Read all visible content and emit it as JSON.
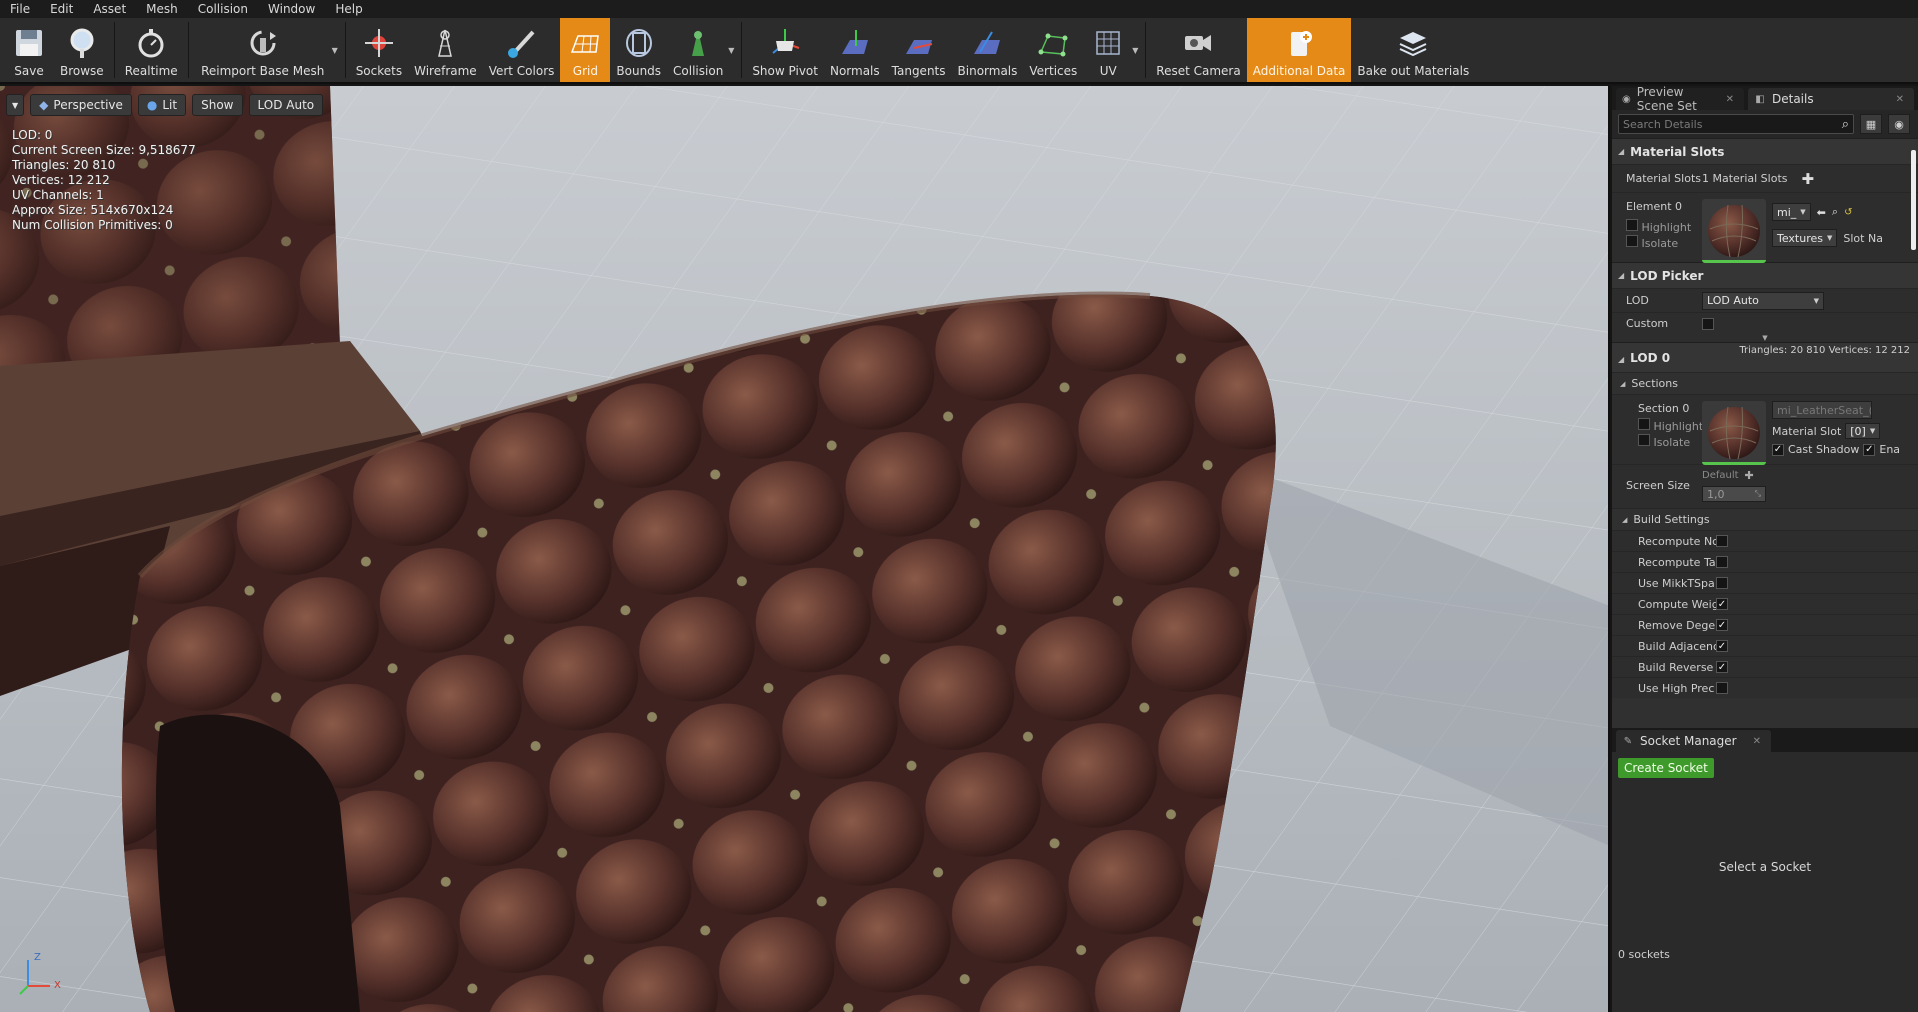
{
  "menu": [
    "File",
    "Edit",
    "Asset",
    "Mesh",
    "Collision",
    "Window",
    "Help"
  ],
  "toolbar": {
    "save": "Save",
    "browse": "Browse",
    "realtime": "Realtime",
    "reimport": "Reimport Base Mesh",
    "sockets": "Sockets",
    "wireframe": "Wireframe",
    "vert_colors": "Vert Colors",
    "grid": "Grid",
    "bounds": "Bounds",
    "collision": "Collision",
    "show_pivot": "Show Pivot",
    "normals": "Normals",
    "tangents": "Tangents",
    "binormals": "Binormals",
    "vertices": "Vertices",
    "uv": "UV",
    "reset_camera": "Reset Camera",
    "additional_data": "Additional Data",
    "bake_out_materials": "Bake out Materials",
    "accent": "#e58a17"
  },
  "viewport": {
    "perspective": "Perspective",
    "lit": "Lit",
    "show": "Show",
    "lod_auto": "LOD Auto",
    "stats": {
      "lod": "LOD:  0",
      "screen_size": "Current Screen Size:  9,518677",
      "triangles": "Triangles:  20 810",
      "vertices": "Vertices:  12 212",
      "uv_channels": "UV Channels:  1",
      "approx_size": "Approx Size: 514x670x124",
      "num_collision": "Num Collision Primitives:  0"
    },
    "axis_x": "X",
    "axis_z": "Z"
  },
  "tabs": {
    "preview_scene": "Preview Scene Set",
    "details": "Details",
    "socket_manager": "Socket Manager"
  },
  "details": {
    "search_placeholder": "Search Details",
    "material_slots_header": "Material Slots",
    "material_slots_label": "Material Slots",
    "material_slots_value": "1 Material Slots",
    "element0": "Element 0",
    "highlight": "Highlight",
    "isolate": "Isolate",
    "mat_dropdown": "mi_",
    "textures": "Textures",
    "slot_name": "Slot Na",
    "lod_picker_header": "LOD Picker",
    "lod_label": "LOD",
    "lod_value": "LOD Auto",
    "custom": "Custom",
    "lod0_header": "LOD 0",
    "lod0_stats": "Triangles: 20 810   Vertices: 12 212",
    "sections": "Sections",
    "section0": "Section 0",
    "section_material": "mi_LeatherSeat_(",
    "material_slot": "Material Slot",
    "material_slot_value": "[0]",
    "cast_shadow": "Cast Shadow",
    "enable": "Ena",
    "screen_size": "Screen Size",
    "default": "Default",
    "screen_size_value": "1,0",
    "build_settings": "Build Settings",
    "build_rows": [
      {
        "label": "Recompute Nc",
        "checked": false
      },
      {
        "label": "Recompute Ta",
        "checked": false
      },
      {
        "label": "Use MikkTSpa",
        "checked": false
      },
      {
        "label": "Compute Weig",
        "checked": true
      },
      {
        "label": "Remove Deger",
        "checked": true
      },
      {
        "label": "Build Adjacenc",
        "checked": true
      },
      {
        "label": "Build Reverse",
        "checked": true
      },
      {
        "label": "Use High Prec",
        "checked": false
      }
    ]
  },
  "socket_manager": {
    "create": "Create Socket",
    "select": "Select a Socket",
    "count": "0 sockets"
  }
}
